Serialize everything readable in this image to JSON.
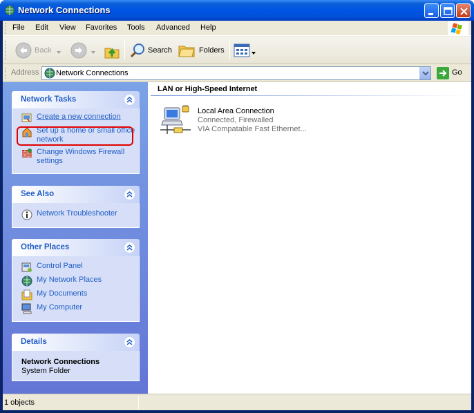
{
  "window": {
    "title": "Network Connections"
  },
  "menu": {
    "items": [
      "File",
      "Edit",
      "View",
      "Favorites",
      "Tools",
      "Advanced",
      "Help"
    ]
  },
  "toolbar": {
    "back_label": "Back",
    "search_label": "Search",
    "folders_label": "Folders"
  },
  "address": {
    "label": "Address",
    "value": "Network Connections",
    "go_label": "Go"
  },
  "network_tasks": {
    "title": "Network Tasks",
    "items": [
      {
        "label": "Create a new connection",
        "icon": "new-connection-icon"
      },
      {
        "label": "Set up a home or small office network",
        "icon": "home-network-icon"
      },
      {
        "label": "Change Windows Firewall settings",
        "icon": "firewall-icon"
      }
    ]
  },
  "see_also": {
    "title": "See Also",
    "items": [
      {
        "label": "Network Troubleshooter",
        "icon": "info-icon"
      }
    ]
  },
  "other_places": {
    "title": "Other Places",
    "items": [
      {
        "label": "Control Panel",
        "icon": "control-panel-icon"
      },
      {
        "label": "My Network Places",
        "icon": "network-places-icon"
      },
      {
        "label": "My Documents",
        "icon": "documents-icon"
      },
      {
        "label": "My Computer",
        "icon": "computer-icon"
      }
    ]
  },
  "details": {
    "title": "Details",
    "name": "Network Connections",
    "type": "System Folder"
  },
  "content": {
    "group_title": "LAN or High-Speed Internet",
    "connection": {
      "name": "Local Area Connection",
      "status": "Connected, Firewalled",
      "device": "VIA Compatable Fast Ethernet..."
    }
  },
  "status": {
    "text": "1 objects"
  },
  "colors": {
    "title_bar": "#0054e3",
    "task_pane": "#6f8ee0",
    "link": "#215dc6",
    "highlight": "#e00000"
  }
}
